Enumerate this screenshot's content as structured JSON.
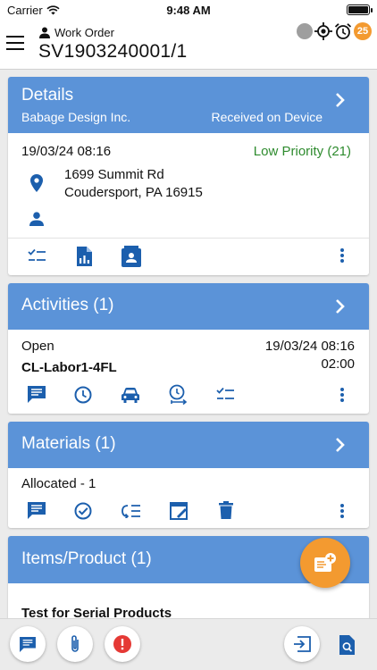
{
  "status_bar": {
    "carrier": "Carrier",
    "time": "9:48 AM",
    "icons": [
      "wifi-icon",
      "battery-icon"
    ]
  },
  "header": {
    "subtitle": "Work Order",
    "title": "SV1903240001/1",
    "badge_count": "25",
    "icons": [
      "menu-icon",
      "person-icon",
      "status-dot-icon",
      "gps-icon",
      "alarm-icon"
    ]
  },
  "details": {
    "title": "Details",
    "company": "Babage Design Inc.",
    "status": "Received on Device",
    "datetime": "19/03/24 08:16",
    "priority": "Low Priority  (21)",
    "address_line1": "1699 Summit Rd",
    "address_line2": "Coudersport, PA 16915",
    "icons": [
      "location-pin-icon",
      "person-icon",
      "checklist-icon",
      "report-icon",
      "contact-card-icon",
      "more-icon"
    ]
  },
  "activities": {
    "title": "Activities (1)",
    "state": "Open",
    "name": "CL-Labor1-4FL",
    "datetime": "19/03/24 08:16",
    "duration": "02:00",
    "icons": [
      "comment-icon",
      "clock-icon",
      "car-icon",
      "timer-icon",
      "checklist-icon",
      "more-icon"
    ]
  },
  "materials": {
    "title": "Materials (1)",
    "allocated": "Allocated  -  1",
    "icons": [
      "comment-icon",
      "check-circle-icon",
      "return-list-icon",
      "edit-note-icon",
      "delete-icon",
      "more-icon"
    ]
  },
  "items": {
    "title": "Items/Product (1)",
    "first_item": "Test for Serial Products"
  },
  "fab": {
    "icon": "add-note-icon"
  },
  "bottom_bar": {
    "icons": [
      "comment-icon",
      "attachment-icon",
      "alert-icon",
      "exit-icon",
      "search-doc-icon"
    ]
  },
  "colors": {
    "header_blue": "#5b93d8",
    "icon_blue": "#1c5fad",
    "priority_green": "#2e8b2e",
    "orange": "#f39a30",
    "alert_red": "#e53935"
  }
}
